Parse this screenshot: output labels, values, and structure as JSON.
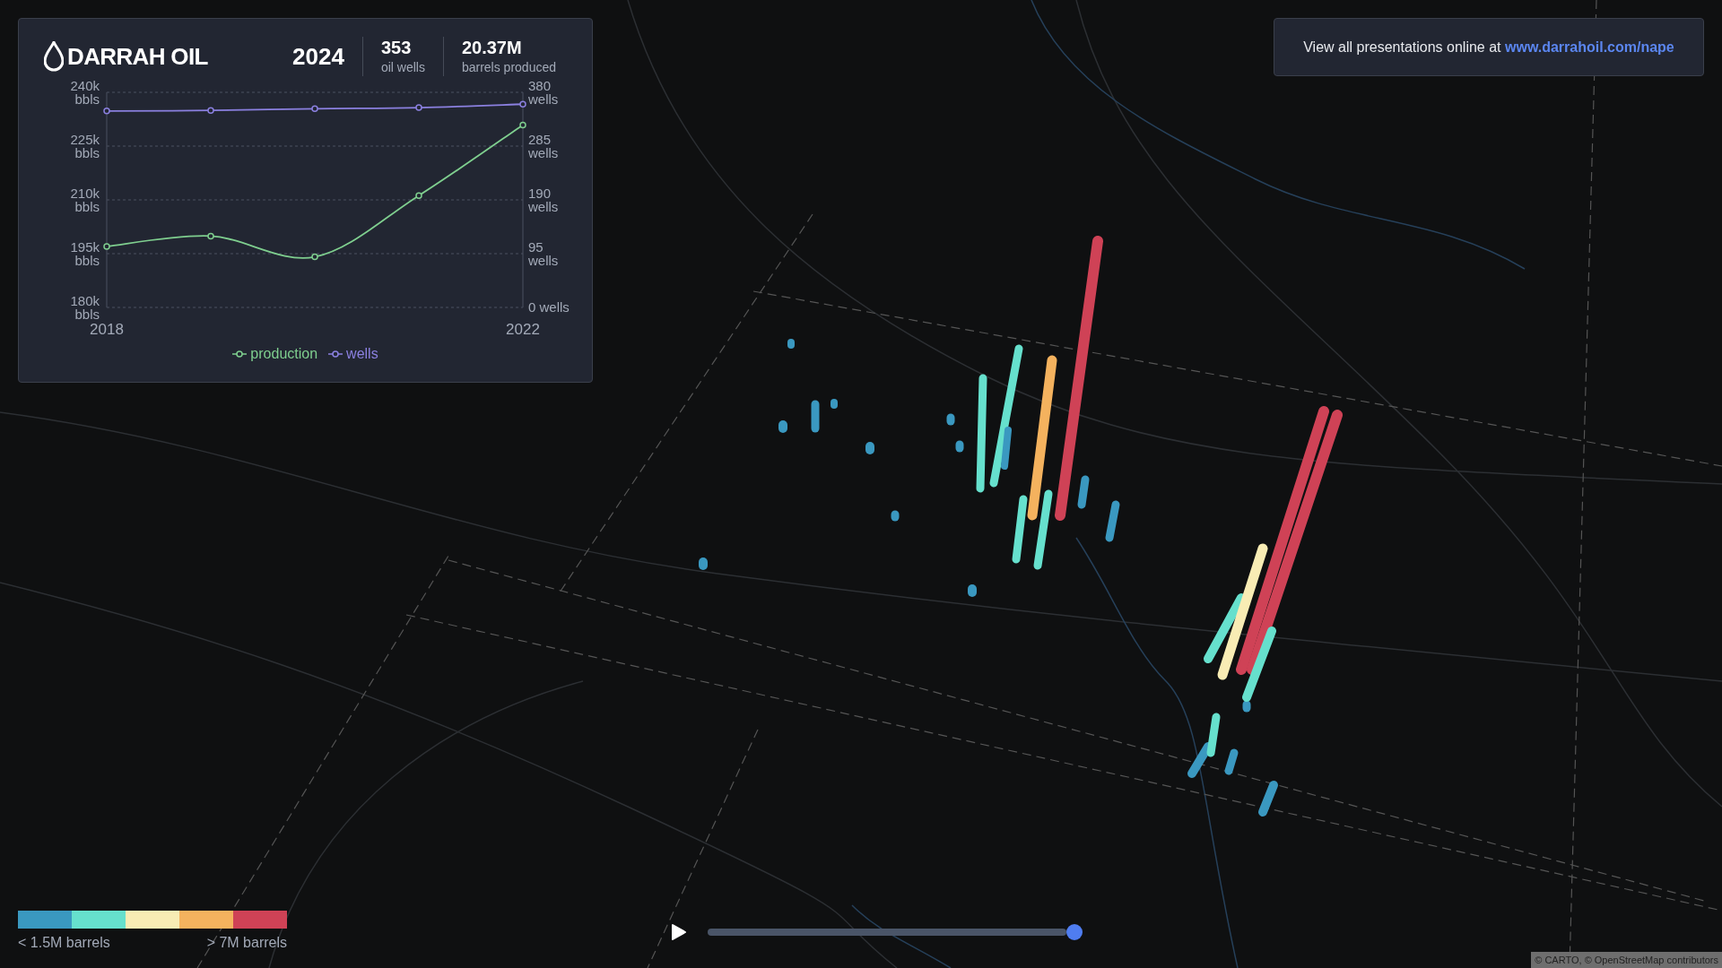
{
  "brand": {
    "name": "DARRAH OIL"
  },
  "stats": [
    {
      "kind": "year",
      "value": "2024"
    },
    {
      "kind": "stat",
      "value": "353",
      "label": "oil wells"
    },
    {
      "kind": "stat",
      "value": "20.37M",
      "label": "barrels produced"
    }
  ],
  "chart": {
    "chart_data": {
      "type": "line",
      "grid": true,
      "legend": "bottom",
      "x": [
        2018,
        2019,
        2020,
        2021,
        2022
      ],
      "xlim": [
        2018,
        2022
      ],
      "xticks": [
        2018,
        2022
      ],
      "ylim": [
        180,
        240
      ],
      "yticks": [
        {
          "value": 180,
          "label": "180k bbls"
        },
        {
          "value": 195,
          "label": "195k bbls"
        },
        {
          "value": 210,
          "label": "210k bbls"
        },
        {
          "value": 225,
          "label": "225k bbls"
        },
        {
          "value": 240,
          "label": "240k bbls"
        }
      ],
      "y2lim": [
        0,
        380
      ],
      "y2ticks": [
        {
          "value": 0,
          "label": "0 wells"
        },
        {
          "value": 95,
          "label": "95 wells"
        },
        {
          "value": 190,
          "label": "190 wells"
        },
        {
          "value": 285,
          "label": "285 wells"
        },
        {
          "value": 380,
          "label": "380 wells"
        }
      ],
      "series": [
        {
          "name": "production",
          "color": "#7fcf8f",
          "axis": "y",
          "marker": "circle",
          "values": [
            197.0,
            199.9,
            194.1,
            211.2,
            230.9
          ]
        },
        {
          "name": "wells",
          "color": "#8b80e0",
          "axis": "y2",
          "marker": "circle",
          "values": [
            347,
            348,
            351,
            353,
            359
          ]
        }
      ]
    }
  },
  "notice": {
    "text": "View all presentations online at",
    "link": "www.darrahoil.com/nape"
  },
  "color_legend": {
    "swatches": [
      {
        "color": "#3a98c0"
      },
      {
        "color": "#66e0cd"
      },
      {
        "color": "#f8ecb4"
      },
      {
        "color": "#f4b25e"
      },
      {
        "color": "#cf4256"
      }
    ],
    "min_label": "< 1.5M barrels",
    "max_label": "> 7M barrels"
  },
  "timeline": {
    "playing": false,
    "level": 1
  },
  "attribution": "© CARTO, © OpenStreetMap contributors"
}
